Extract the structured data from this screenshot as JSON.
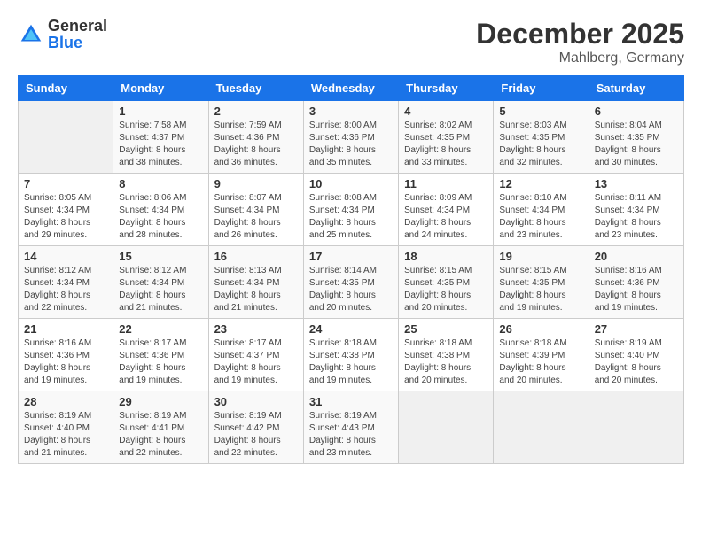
{
  "logo": {
    "text_general": "General",
    "text_blue": "Blue"
  },
  "title": "December 2025",
  "subtitle": "Mahlberg, Germany",
  "days_of_week": [
    "Sunday",
    "Monday",
    "Tuesday",
    "Wednesday",
    "Thursday",
    "Friday",
    "Saturday"
  ],
  "weeks": [
    [
      {
        "day": "",
        "info": ""
      },
      {
        "day": "1",
        "info": "Sunrise: 7:58 AM\nSunset: 4:37 PM\nDaylight: 8 hours\nand 38 minutes."
      },
      {
        "day": "2",
        "info": "Sunrise: 7:59 AM\nSunset: 4:36 PM\nDaylight: 8 hours\nand 36 minutes."
      },
      {
        "day": "3",
        "info": "Sunrise: 8:00 AM\nSunset: 4:36 PM\nDaylight: 8 hours\nand 35 minutes."
      },
      {
        "day": "4",
        "info": "Sunrise: 8:02 AM\nSunset: 4:35 PM\nDaylight: 8 hours\nand 33 minutes."
      },
      {
        "day": "5",
        "info": "Sunrise: 8:03 AM\nSunset: 4:35 PM\nDaylight: 8 hours\nand 32 minutes."
      },
      {
        "day": "6",
        "info": "Sunrise: 8:04 AM\nSunset: 4:35 PM\nDaylight: 8 hours\nand 30 minutes."
      }
    ],
    [
      {
        "day": "7",
        "info": "Sunrise: 8:05 AM\nSunset: 4:34 PM\nDaylight: 8 hours\nand 29 minutes."
      },
      {
        "day": "8",
        "info": "Sunrise: 8:06 AM\nSunset: 4:34 PM\nDaylight: 8 hours\nand 28 minutes."
      },
      {
        "day": "9",
        "info": "Sunrise: 8:07 AM\nSunset: 4:34 PM\nDaylight: 8 hours\nand 26 minutes."
      },
      {
        "day": "10",
        "info": "Sunrise: 8:08 AM\nSunset: 4:34 PM\nDaylight: 8 hours\nand 25 minutes."
      },
      {
        "day": "11",
        "info": "Sunrise: 8:09 AM\nSunset: 4:34 PM\nDaylight: 8 hours\nand 24 minutes."
      },
      {
        "day": "12",
        "info": "Sunrise: 8:10 AM\nSunset: 4:34 PM\nDaylight: 8 hours\nand 23 minutes."
      },
      {
        "day": "13",
        "info": "Sunrise: 8:11 AM\nSunset: 4:34 PM\nDaylight: 8 hours\nand 23 minutes."
      }
    ],
    [
      {
        "day": "14",
        "info": "Sunrise: 8:12 AM\nSunset: 4:34 PM\nDaylight: 8 hours\nand 22 minutes."
      },
      {
        "day": "15",
        "info": "Sunrise: 8:12 AM\nSunset: 4:34 PM\nDaylight: 8 hours\nand 21 minutes."
      },
      {
        "day": "16",
        "info": "Sunrise: 8:13 AM\nSunset: 4:34 PM\nDaylight: 8 hours\nand 21 minutes."
      },
      {
        "day": "17",
        "info": "Sunrise: 8:14 AM\nSunset: 4:35 PM\nDaylight: 8 hours\nand 20 minutes."
      },
      {
        "day": "18",
        "info": "Sunrise: 8:15 AM\nSunset: 4:35 PM\nDaylight: 8 hours\nand 20 minutes."
      },
      {
        "day": "19",
        "info": "Sunrise: 8:15 AM\nSunset: 4:35 PM\nDaylight: 8 hours\nand 19 minutes."
      },
      {
        "day": "20",
        "info": "Sunrise: 8:16 AM\nSunset: 4:36 PM\nDaylight: 8 hours\nand 19 minutes."
      }
    ],
    [
      {
        "day": "21",
        "info": "Sunrise: 8:16 AM\nSunset: 4:36 PM\nDaylight: 8 hours\nand 19 minutes."
      },
      {
        "day": "22",
        "info": "Sunrise: 8:17 AM\nSunset: 4:36 PM\nDaylight: 8 hours\nand 19 minutes."
      },
      {
        "day": "23",
        "info": "Sunrise: 8:17 AM\nSunset: 4:37 PM\nDaylight: 8 hours\nand 19 minutes."
      },
      {
        "day": "24",
        "info": "Sunrise: 8:18 AM\nSunset: 4:38 PM\nDaylight: 8 hours\nand 19 minutes."
      },
      {
        "day": "25",
        "info": "Sunrise: 8:18 AM\nSunset: 4:38 PM\nDaylight: 8 hours\nand 20 minutes."
      },
      {
        "day": "26",
        "info": "Sunrise: 8:18 AM\nSunset: 4:39 PM\nDaylight: 8 hours\nand 20 minutes."
      },
      {
        "day": "27",
        "info": "Sunrise: 8:19 AM\nSunset: 4:40 PM\nDaylight: 8 hours\nand 20 minutes."
      }
    ],
    [
      {
        "day": "28",
        "info": "Sunrise: 8:19 AM\nSunset: 4:40 PM\nDaylight: 8 hours\nand 21 minutes."
      },
      {
        "day": "29",
        "info": "Sunrise: 8:19 AM\nSunset: 4:41 PM\nDaylight: 8 hours\nand 22 minutes."
      },
      {
        "day": "30",
        "info": "Sunrise: 8:19 AM\nSunset: 4:42 PM\nDaylight: 8 hours\nand 22 minutes."
      },
      {
        "day": "31",
        "info": "Sunrise: 8:19 AM\nSunset: 4:43 PM\nDaylight: 8 hours\nand 23 minutes."
      },
      {
        "day": "",
        "info": ""
      },
      {
        "day": "",
        "info": ""
      },
      {
        "day": "",
        "info": ""
      }
    ]
  ]
}
